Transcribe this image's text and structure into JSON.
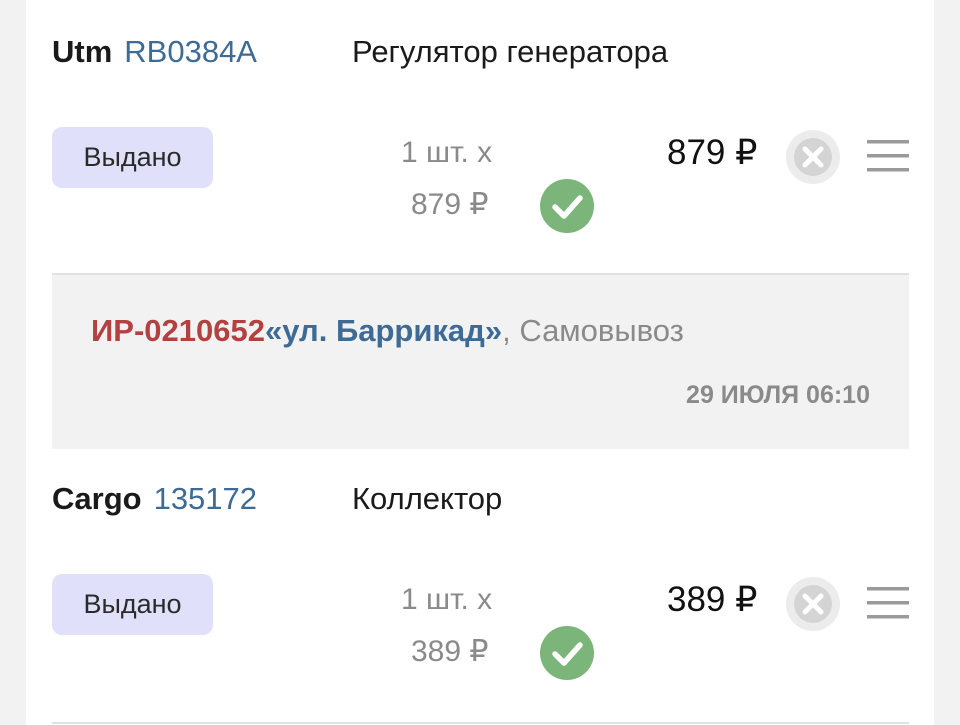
{
  "orders": [
    {
      "brand": "Utm",
      "article": "RB0384A",
      "name": "Регулятор генератора",
      "status": "Выдано",
      "qty": "1 шт. x",
      "unit_price": "879 ₽",
      "total": "879 ₽"
    },
    {
      "brand": "Cargo",
      "article": "135172",
      "name": "Коллектор",
      "status": "Выдано",
      "qty": "1 шт. x",
      "unit_price": "389 ₽",
      "total": "389 ₽"
    }
  ],
  "pickup": {
    "order_no": "ИР-0210652",
    "store": "«ул. Баррикад»",
    "separator": ", ",
    "method": "Самовывоз",
    "date": "29 ИЮЛЯ 06:10"
  },
  "icons": {
    "check": "check-circle-icon",
    "remove": "remove-circle-icon",
    "menu": "menu-lines-icon"
  },
  "colors": {
    "status_bg": "#e1e0fb",
    "check_green": "#7cb57a",
    "order_red": "#b2413f",
    "link_blue": "#3d6b96"
  }
}
